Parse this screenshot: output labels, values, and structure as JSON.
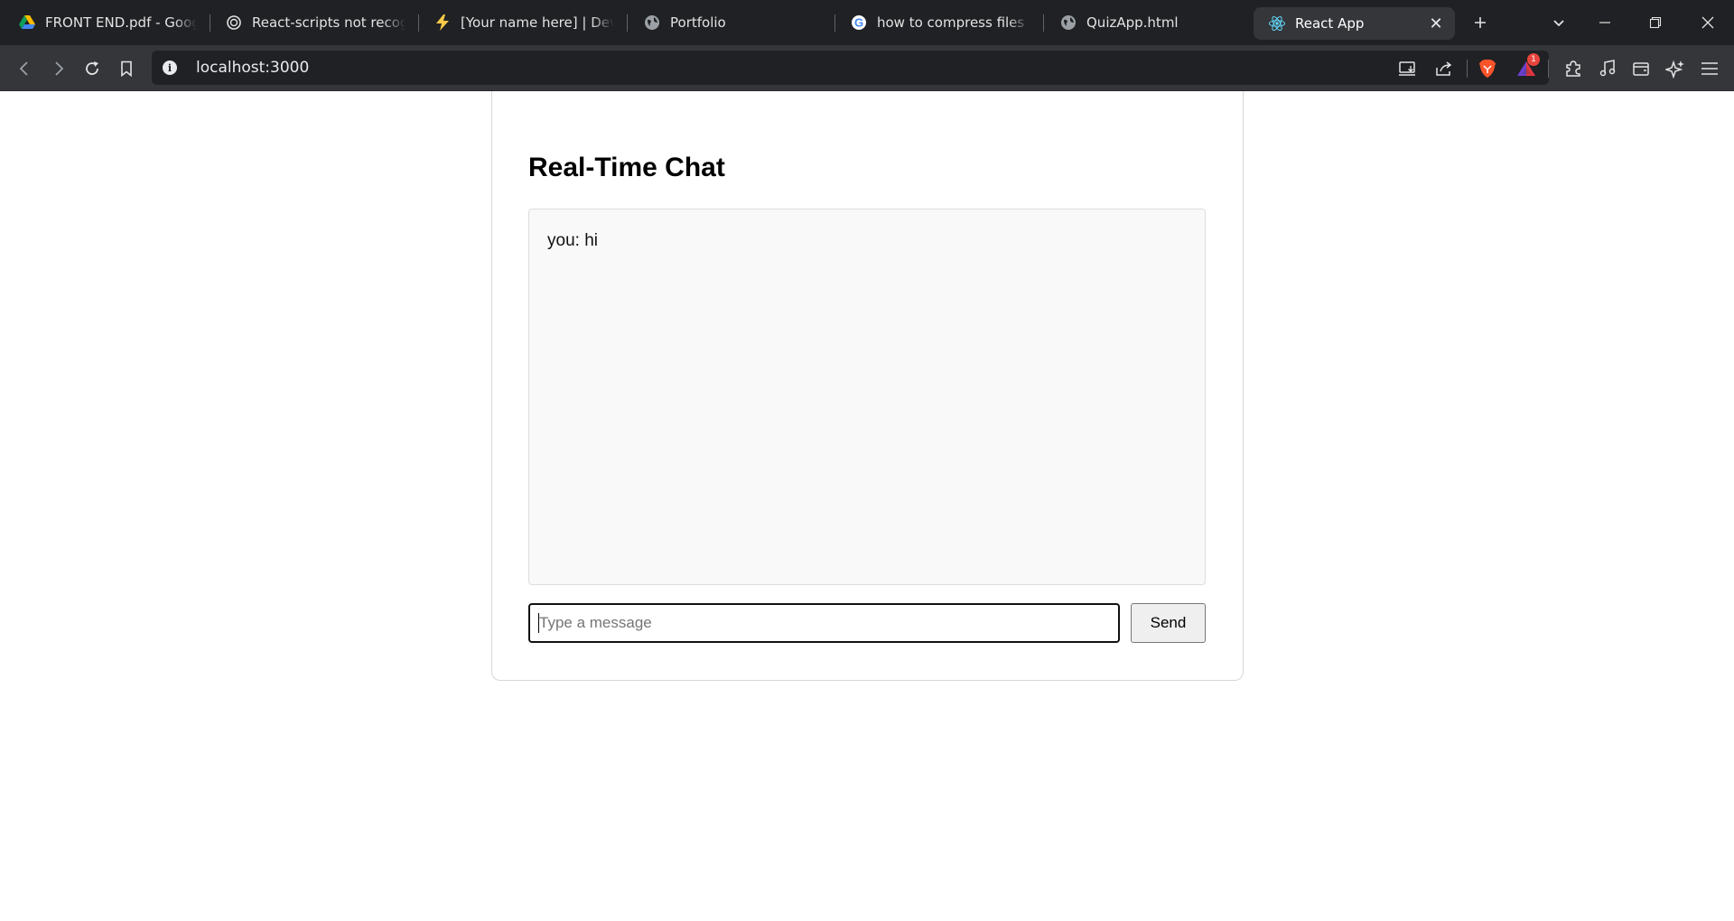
{
  "browser": {
    "tabs": [
      {
        "title": "FRONT END.pdf - Google Drive",
        "icon": "google-drive-icon"
      },
      {
        "title": "React-scripts not recognized",
        "icon": "chatgpt-icon"
      },
      {
        "title": "[Your name here] | Developer",
        "icon": "bolt-icon"
      },
      {
        "title": "Portfolio",
        "icon": "globe-icon"
      },
      {
        "title": "how to compress files to",
        "icon": "google-icon"
      },
      {
        "title": "QuizApp.html",
        "icon": "globe-icon"
      },
      {
        "title": "React App",
        "icon": "react-icon",
        "active": true
      }
    ],
    "address": "localhost:3000",
    "notification_count": "1"
  },
  "page": {
    "title": "Real-Time Chat",
    "messages": [
      {
        "text": "you: hi"
      }
    ],
    "input": {
      "placeholder": "Type a message",
      "value": ""
    },
    "send_label": "Send"
  },
  "colors": {
    "tabstrip_bg": "#202124",
    "toolbar_bg": "#35363a",
    "brave_orange": "#fb542b"
  }
}
